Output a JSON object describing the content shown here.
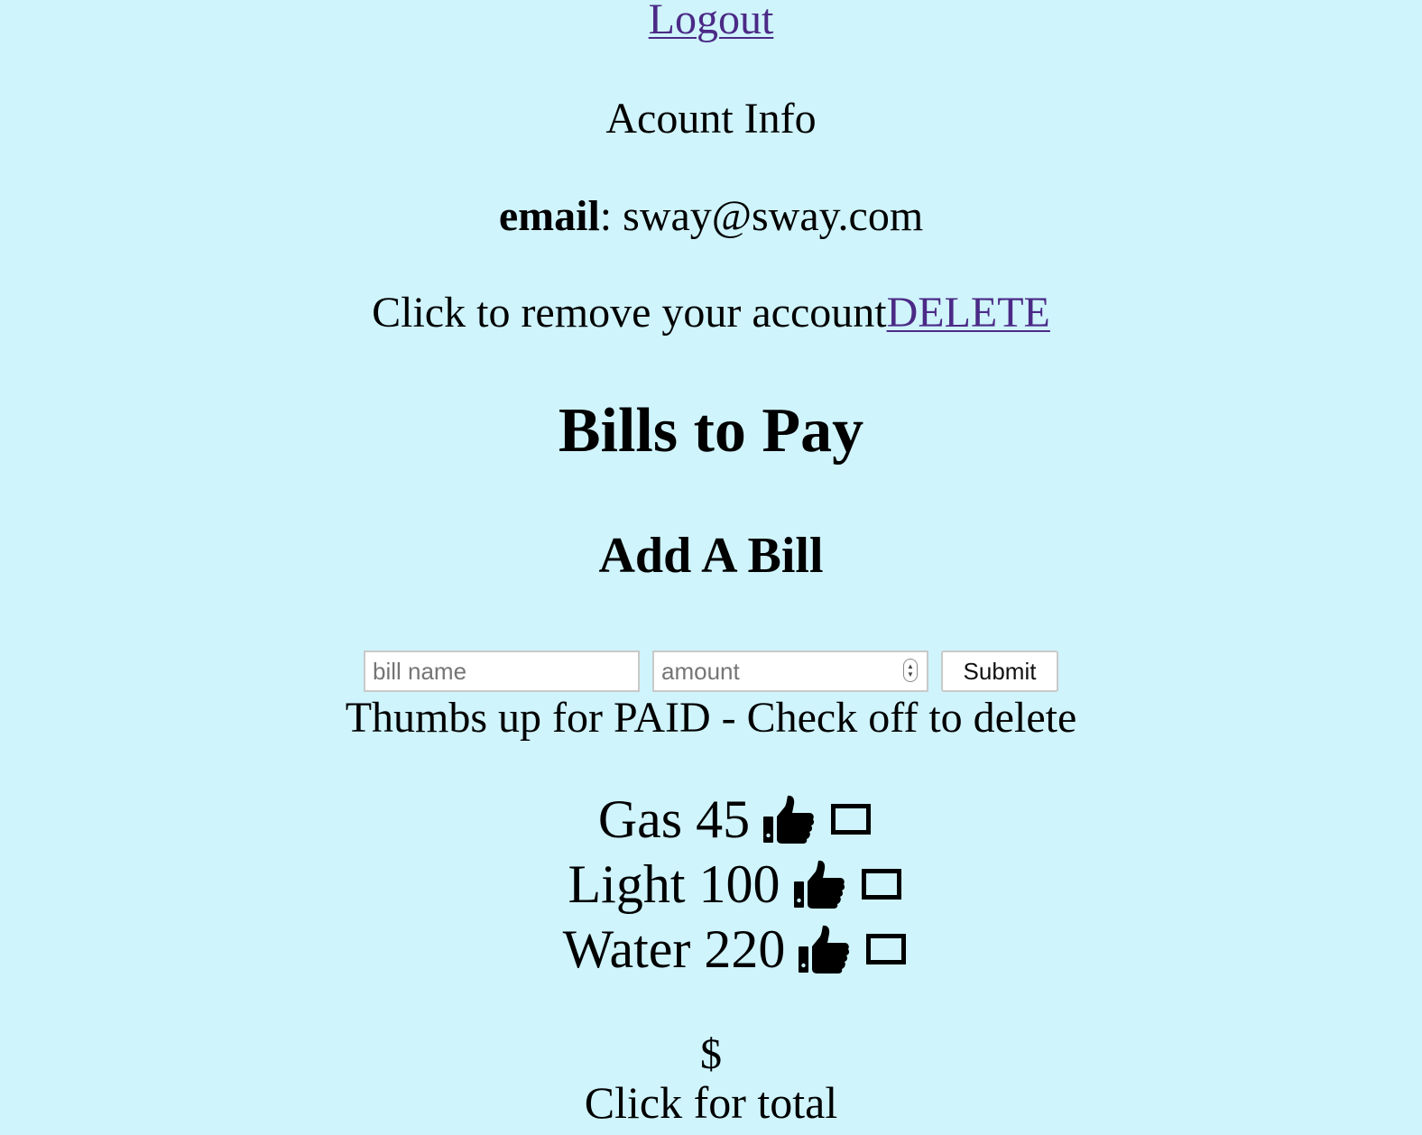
{
  "header": {
    "logout_label": "Logout"
  },
  "account": {
    "title": "Acount Info",
    "email_label": "email",
    "email_value": "sway@sway.com",
    "remove_text": "Click to remove your account",
    "delete_label": "DELETE"
  },
  "bills": {
    "title": "Bills to Pay",
    "add_title": "Add A Bill",
    "form": {
      "name_placeholder": "bill name",
      "amount_placeholder": "amount",
      "submit_label": "Submit"
    },
    "instructions": "Thumbs up for PAID - Check off to delete",
    "items": [
      {
        "name": "Gas",
        "amount": "45"
      },
      {
        "name": "Light",
        "amount": "100"
      },
      {
        "name": "Water",
        "amount": "220"
      }
    ],
    "icons": {
      "paid": "thumbs-up-icon",
      "delete": "checkbox-icon"
    },
    "total_symbol": "$",
    "total_label": "Click for total"
  },
  "colors": {
    "background": "#cff4fc",
    "link": "#4b2a86"
  }
}
